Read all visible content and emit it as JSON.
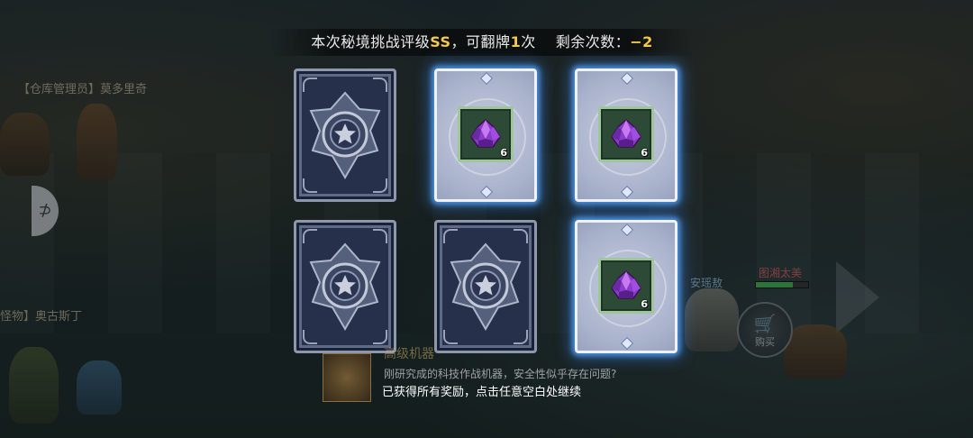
{
  "header": {
    "text_prefix": "本次秘境挑战评级",
    "rating": "SS",
    "text_mid": "，可翻牌",
    "flips": "1",
    "text_suffix": "次",
    "remaining_label": "剩余次数：",
    "remaining_value": "−2"
  },
  "npcs": [
    {
      "label": "【仓库管理员】莫多里奇"
    },
    {
      "label": "怪物】奥古斯丁"
    }
  ],
  "players": [
    {
      "name": "安瑶敖",
      "color": "#9cc3e8"
    },
    {
      "name": "图湘太美",
      "color": "#e06060"
    }
  ],
  "player_hp_fraction": 0.7,
  "buy_button": {
    "label": "购买",
    "icon": "cart-icon"
  },
  "dialog": {
    "title": "高级机器",
    "line1": "刚研究成的科技作战机器，安全性似乎存在问题?",
    "line2": "已获得所有奖励，点击任意空白处继续"
  },
  "cards": [
    {
      "state": "back"
    },
    {
      "state": "revealed",
      "item_icon": "purple-crystal-icon",
      "count": "6"
    },
    {
      "state": "revealed",
      "item_icon": "purple-crystal-icon",
      "count": "6"
    },
    {
      "state": "back"
    },
    {
      "state": "back"
    },
    {
      "state": "revealed",
      "item_icon": "purple-crystal-icon",
      "count": "6"
    }
  ],
  "colors": {
    "highlight": "#f5c84a",
    "card_glow": "#4aa0ff",
    "item_frame": "#9fc59a"
  }
}
